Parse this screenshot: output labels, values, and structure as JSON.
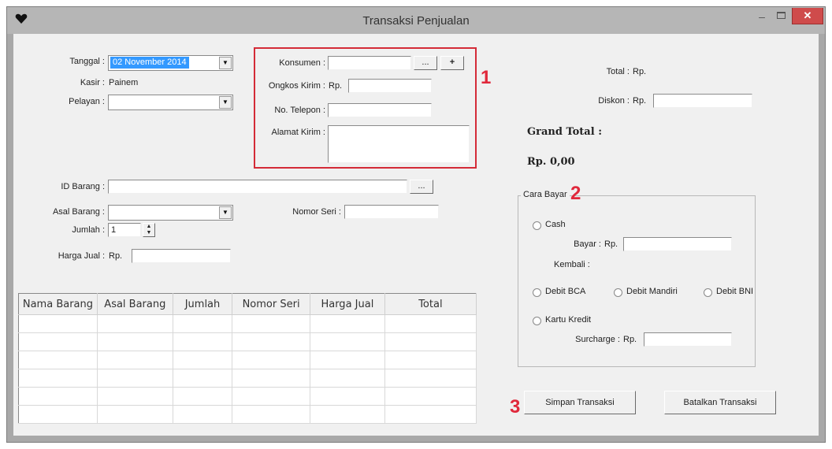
{
  "window": {
    "title": "Transaksi Penjualan",
    "minimize_glyph": "–",
    "close_glyph": "✕"
  },
  "header": {
    "tanggal": {
      "label": "Tanggal :",
      "value": "02 November 2014"
    },
    "kasir": {
      "label": "Kasir :",
      "value": "Painem"
    },
    "pelayan": {
      "label": "Pelayan :",
      "value": ""
    }
  },
  "customer": {
    "konsumen": {
      "label": "Konsumen :",
      "value": "",
      "browse": "...",
      "add": "+"
    },
    "ongkos_kirim": {
      "label": "Ongkos Kirim :",
      "currency": "Rp.",
      "value": ""
    },
    "telepon": {
      "label": "No. Telepon :",
      "value": ""
    },
    "alamat": {
      "label": "Alamat Kirim :",
      "value": ""
    }
  },
  "item": {
    "id_barang": {
      "label": "ID Barang :",
      "value": "",
      "browse": "..."
    },
    "asal_barang": {
      "label": "Asal Barang :",
      "value": ""
    },
    "nomor_seri": {
      "label": "Nomor Seri :",
      "value": ""
    },
    "jumlah": {
      "label": "Jumlah :",
      "value": "1"
    },
    "harga_jual": {
      "label": "Harga Jual :",
      "currency": "Rp.",
      "value": ""
    }
  },
  "table": {
    "columns": [
      "Nama Barang",
      "Asal Barang",
      "Jumlah",
      "Nomor Seri",
      "Harga Jual",
      "Total"
    ],
    "rows": [
      [
        "",
        "",
        "",
        "",
        "",
        ""
      ],
      [
        "",
        "",
        "",
        "",
        "",
        ""
      ],
      [
        "",
        "",
        "",
        "",
        "",
        ""
      ],
      [
        "",
        "",
        "",
        "",
        "",
        ""
      ],
      [
        "",
        "",
        "",
        "",
        "",
        ""
      ],
      [
        "",
        "",
        "",
        "",
        "",
        ""
      ]
    ]
  },
  "summary": {
    "total": {
      "label": "Total :",
      "value": "Rp."
    },
    "diskon": {
      "label": "Diskon :",
      "currency": "Rp.",
      "value": ""
    },
    "grand_total_label": "Grand Total :",
    "grand_total_value": "Rp. 0,00"
  },
  "payment": {
    "legend": "Cara Bayar",
    "cash": "Cash",
    "bayar": {
      "label": "Bayar :",
      "currency": "Rp.",
      "value": ""
    },
    "kembali": "Kembali :",
    "debit_bca": "Debit BCA",
    "debit_mandiri": "Debit Mandiri",
    "debit_bni": "Debit BNI",
    "kartu_kredit": "Kartu Kredit",
    "surcharge": {
      "label": "Surcharge :",
      "currency": "Rp.",
      "value": ""
    }
  },
  "actions": {
    "save": "Simpan Transaksi",
    "cancel": "Batalkan Transaksi"
  },
  "annotations": {
    "n1": "1",
    "n2": "2",
    "n3": "3"
  },
  "colors": {
    "annotation_red": "#d42b37",
    "selection_blue": "#3399ff",
    "close_red": "#cf4b4b"
  }
}
